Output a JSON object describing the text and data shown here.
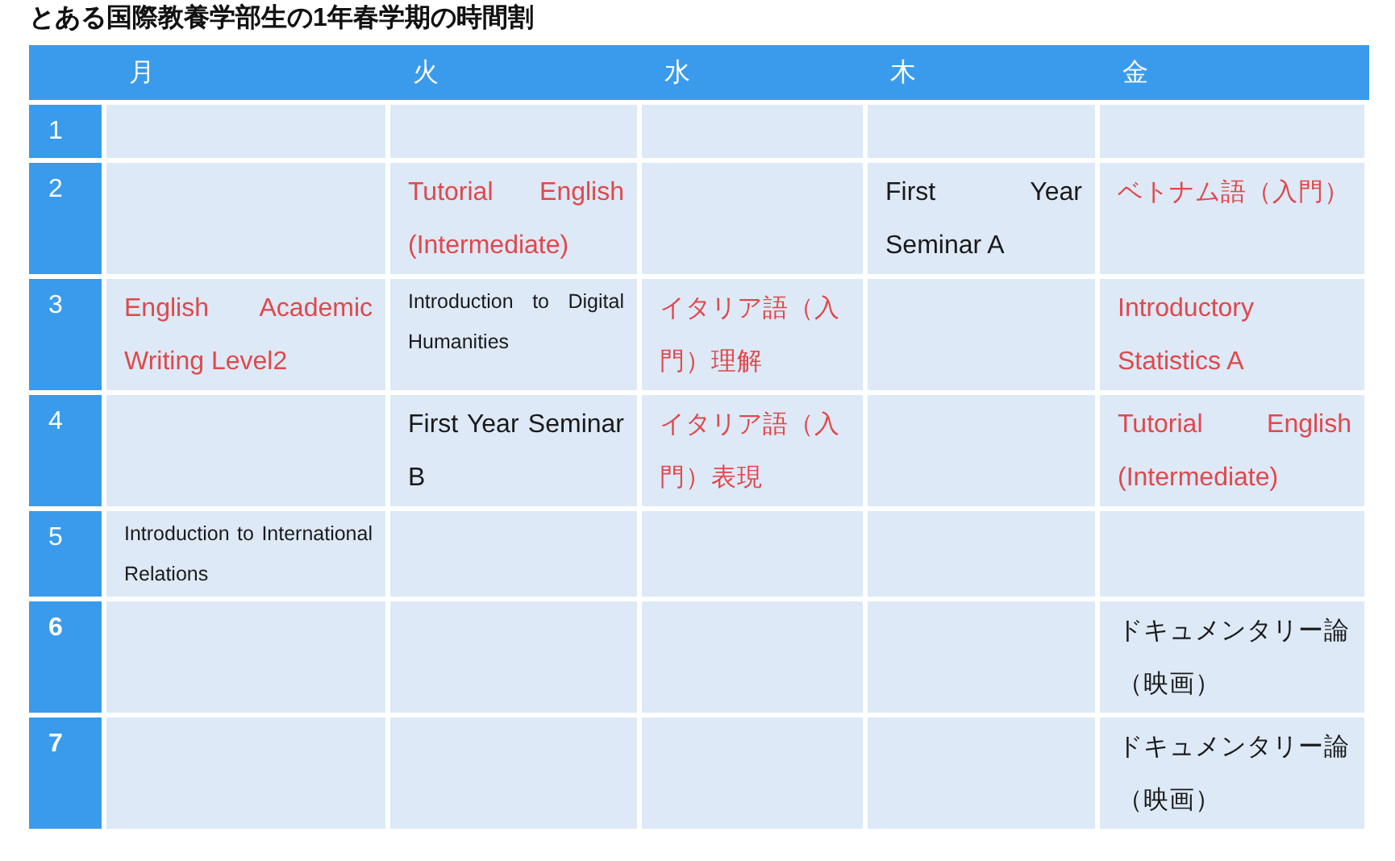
{
  "title": "とある国際教養学部生の1年春学期の時間割",
  "columns": [
    "月",
    "火",
    "水",
    "木",
    "金"
  ],
  "rows": [
    {
      "label": "1",
      "bold": false,
      "cells": [
        null,
        null,
        null,
        null,
        null
      ]
    },
    {
      "label": "2",
      "bold": false,
      "cells": [
        null,
        {
          "text": "Tutorial English (Intermediate)",
          "emphasis": true,
          "small": false
        },
        null,
        {
          "text": "First Year Seminar A",
          "emphasis": false,
          "small": false
        },
        {
          "text": "ベトナム語（入門）",
          "kind": "cjk",
          "emphasis": true,
          "small": false
        }
      ]
    },
    {
      "label": "3",
      "bold": false,
      "cells": [
        {
          "text": "English Academic Writing Level2",
          "emphasis": true,
          "small": false
        },
        {
          "text": "Introduction to Digital Humanities",
          "emphasis": false,
          "small": true
        },
        {
          "text": "イタリア語（入門）理解",
          "kind": "cjk",
          "emphasis": true,
          "small": false
        },
        null,
        {
          "text": "Introductory Statistics A",
          "emphasis": true,
          "small": false
        }
      ]
    },
    {
      "label": "4",
      "bold": false,
      "cells": [
        null,
        {
          "text": "First Year Seminar B",
          "emphasis": false,
          "small": false
        },
        {
          "text": "イタリア語（入門）表現",
          "kind": "cjk",
          "emphasis": true,
          "small": false
        },
        null,
        {
          "text": "Tutorial English (Intermediate)",
          "emphasis": true,
          "small": false
        }
      ]
    },
    {
      "label": "5",
      "bold": false,
      "cells": [
        {
          "text": "Introduction to International Relations",
          "emphasis": false,
          "small": true
        },
        null,
        null,
        null,
        null
      ]
    },
    {
      "label": "6",
      "bold": true,
      "cells": [
        null,
        null,
        null,
        null,
        {
          "text": "ドキュメンタリー論（映画）",
          "kind": "cjk",
          "emphasis": false,
          "small": false
        }
      ]
    },
    {
      "label": "7",
      "bold": true,
      "cells": [
        null,
        null,
        null,
        null,
        {
          "text": "ドキュメンタリー論（映画）",
          "kind": "cjk",
          "emphasis": false,
          "small": false
        }
      ]
    }
  ]
}
